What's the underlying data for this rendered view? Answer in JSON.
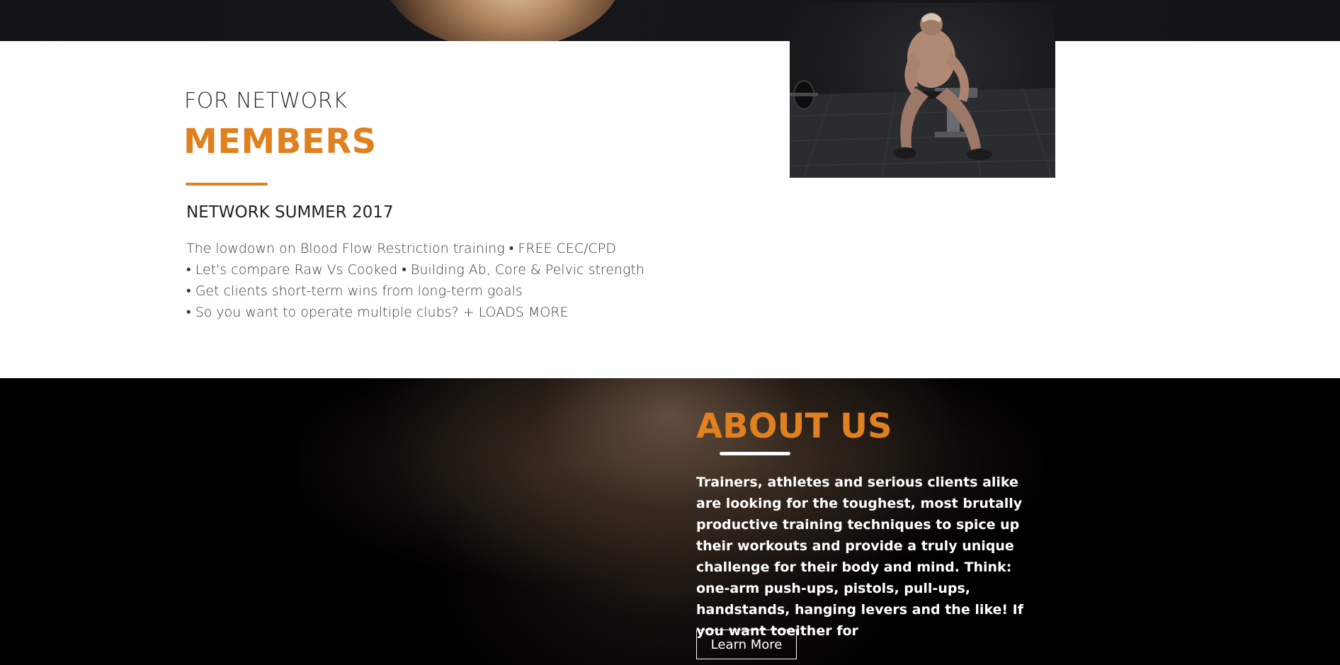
{
  "members": {
    "kicker": "FOR NETWORK",
    "title": "MEMBERS",
    "issue_title": "NETWORK SUMMER 2017",
    "issue_lines": [
      "The lowdown on Blood Flow Restriction training • FREE CEC/CPD",
      "• Let's compare Raw Vs Cooked • Building Ab, Core & Pelvic strength",
      "• Get clients short-term wins from long-term goals",
      "• So you want to operate multiple clubs? + LOADS MORE"
    ]
  },
  "about": {
    "title": "ABOUT US",
    "text": "Trainers, athletes and serious clients alike are looking for the toughest, most brutally productive training techniques to spice up their workouts and provide a truly unique challenge for their body and mind. Think: one-arm push-ups, pistols, pull-ups, handstands, hanging levers and the like! If you want toeither for",
    "button_label": "Learn More"
  },
  "colors": {
    "accent": "#e0801f",
    "dark": "#000000",
    "strip": "#121418"
  }
}
